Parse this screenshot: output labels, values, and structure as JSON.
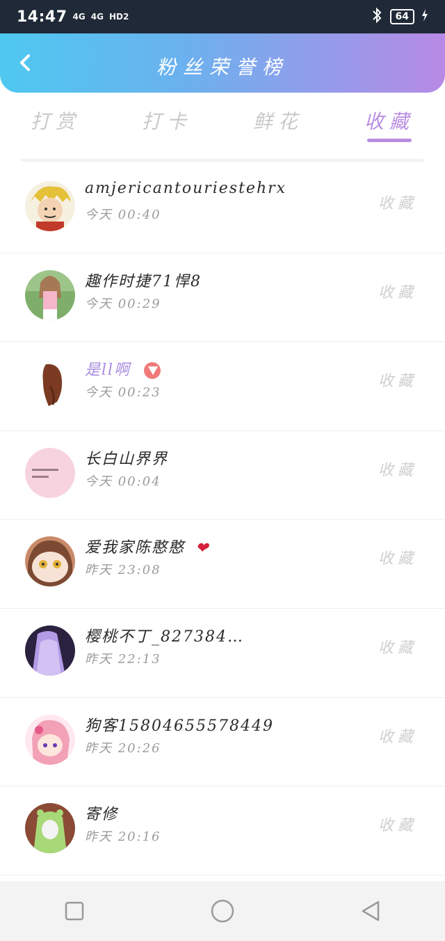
{
  "status_bar": {
    "time": "14:47",
    "signal_1": "4G",
    "signal_2": "4G",
    "hd": "HD2",
    "battery": "64"
  },
  "header": {
    "title": "粉丝荣誉榜"
  },
  "tabs": [
    {
      "label": "打赏",
      "active": false
    },
    {
      "label": "打卡",
      "active": false
    },
    {
      "label": "鲜花",
      "active": false
    },
    {
      "label": "收藏",
      "active": true
    }
  ],
  "list": [
    {
      "name": "amjericantouriestehrx",
      "time": "今天 00:40",
      "action": "收藏",
      "avatar": "cartoon-boy"
    },
    {
      "name": "趣作时捷71悍8",
      "time": "今天 00:29",
      "action": "收藏",
      "avatar": "girl-photo"
    },
    {
      "name": "是ll啊",
      "time": "今天 00:23",
      "action": "收藏",
      "avatar": "girl-hair"
    },
    {
      "name": "长白山界界",
      "time": "今天 00:04",
      "action": "收藏",
      "avatar": "pink-text"
    },
    {
      "name": "爱我家陈憨憨",
      "time": "昨天 23:08",
      "action": "收藏",
      "avatar": "anime-girl"
    },
    {
      "name": "樱桃不丁_827384…",
      "time": "昨天 22:13",
      "action": "收藏",
      "avatar": "purple-dress"
    },
    {
      "name": "狗客15804655578449",
      "time": "昨天 20:26",
      "action": "收藏",
      "avatar": "pink-anime"
    },
    {
      "name": "寄修",
      "time": "昨天 20:16",
      "action": "收藏",
      "avatar": "green-hood"
    }
  ],
  "colors": {
    "accent": "#b98de2",
    "header_start": "#4ec8f0",
    "header_end": "#b78ae6"
  }
}
